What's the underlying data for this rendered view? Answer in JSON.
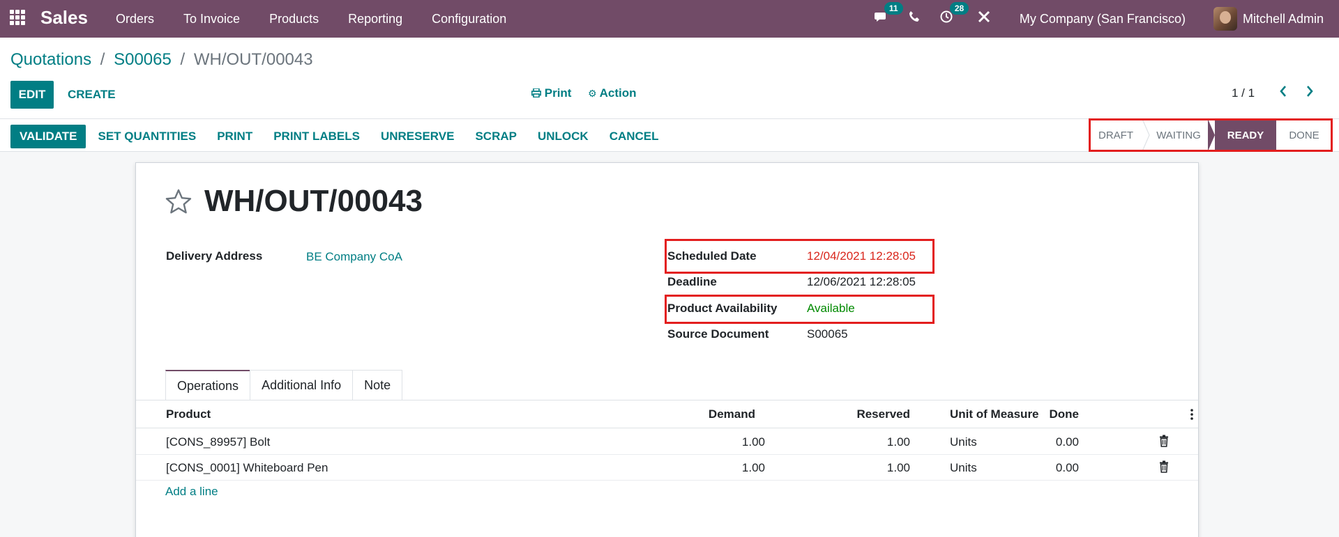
{
  "navbar": {
    "brand": "Sales",
    "menu": [
      "Orders",
      "To Invoice",
      "Products",
      "Reporting",
      "Configuration"
    ],
    "messages_count": "11",
    "activities_count": "28",
    "company": "My Company (San Francisco)",
    "user": "Mitchell Admin"
  },
  "breadcrumb": {
    "items": [
      "Quotations",
      "S00065"
    ],
    "separator": "/",
    "current": "WH/OUT/00043"
  },
  "control": {
    "edit_label": "EDIT",
    "create_label": "CREATE",
    "print_label": "Print",
    "action_label": "Action",
    "pager": "1 / 1"
  },
  "statusbar": {
    "buttons": [
      "VALIDATE",
      "SET QUANTITIES",
      "PRINT",
      "PRINT LABELS",
      "UNRESERVE",
      "SCRAP",
      "UNLOCK",
      "CANCEL"
    ],
    "stages": [
      "DRAFT",
      "WAITING",
      "READY",
      "DONE"
    ],
    "active_stage": "READY"
  },
  "record": {
    "title": "WH/OUT/00043",
    "delivery_address_label": "Delivery Address",
    "delivery_address": "BE Company CoA",
    "scheduled_date_label": "Scheduled Date",
    "scheduled_date": "12/04/2021 12:28:05",
    "deadline_label": "Deadline",
    "deadline": "12/06/2021 12:28:05",
    "availability_label": "Product Availability",
    "availability": "Available",
    "source_label": "Source Document",
    "source": "S00065"
  },
  "tabs": [
    "Operations",
    "Additional Info",
    "Note"
  ],
  "table": {
    "headers": {
      "product": "Product",
      "demand": "Demand",
      "reserved": "Reserved",
      "done": "Done",
      "uom": "Unit of Measure"
    },
    "rows": [
      {
        "product": "[CONS_89957] Bolt",
        "demand": "1.00",
        "reserved": "1.00",
        "done": "0.00",
        "uom": "Units"
      },
      {
        "product": "[CONS_0001] Whiteboard Pen",
        "demand": "1.00",
        "reserved": "1.00",
        "done": "0.00",
        "uom": "Units"
      }
    ],
    "add_line": "Add a line"
  },
  "colors": {
    "brand": "#714b67",
    "accent": "#017e84",
    "highlight": "#e31e1e",
    "late_date": "#d9261c",
    "available": "#008a00"
  }
}
